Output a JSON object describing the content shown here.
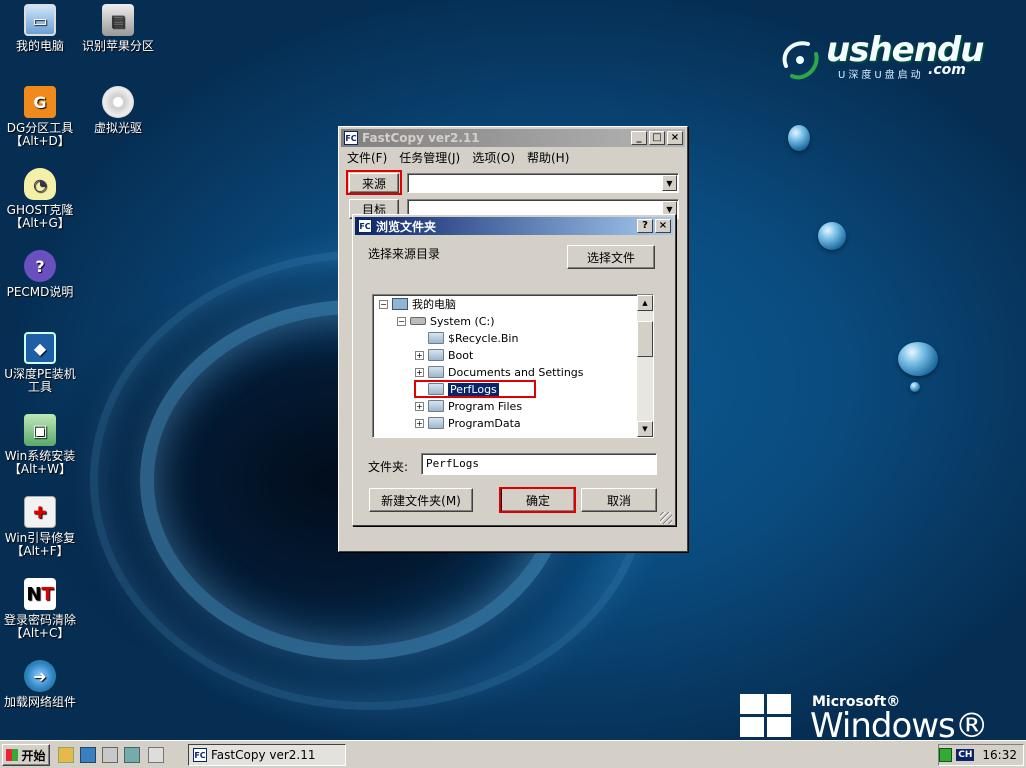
{
  "desktop": {
    "icons": [
      {
        "label": "我的电脑",
        "icon": "computer-icon"
      },
      {
        "label": "识别苹果分区",
        "icon": "disk-icon"
      },
      {
        "label": "DG分区工具\n【Alt+D】",
        "icon": "diskgenius-icon"
      },
      {
        "label": "虚拟光驱",
        "icon": "cd-icon"
      },
      {
        "label": "GHOST克隆\n【Alt+G】",
        "icon": "ghost-icon"
      },
      {
        "label": "PECMD说明",
        "icon": "help-icon"
      },
      {
        "label": "U深度PE装机\n工具",
        "icon": "installer-icon"
      },
      {
        "label": "Win系统安装\n【Alt+W】",
        "icon": "win-setup-icon"
      },
      {
        "label": "Win引导修复\n【Alt+F】",
        "icon": "boot-repair-icon"
      },
      {
        "label": "登录密码清除\n【Alt+C】",
        "icon": "password-icon"
      },
      {
        "label": "加载网络组件",
        "icon": "network-icon"
      }
    ]
  },
  "logo": {
    "word": "ushendu",
    "com": ".com",
    "sub": "U深度U盘启动"
  },
  "winpe": {
    "microsoft": "Microsoft®",
    "windows": "Windows® PE"
  },
  "fastcopy": {
    "title": "FastCopy ver2.11",
    "menu": [
      "文件(F)",
      "任务管理(J)",
      "选项(O)",
      "帮助(H)"
    ],
    "source_button": "来源",
    "dest_button": "目标"
  },
  "browse": {
    "title": "浏览文件夹",
    "prompt": "选择来源目录",
    "select_file_button": "选择文件",
    "tree": [
      {
        "label": "我的电脑",
        "level": 0,
        "expander": "−",
        "type": "computer"
      },
      {
        "label": "System (C:)",
        "level": 1,
        "expander": "−",
        "type": "drive"
      },
      {
        "label": "$Recycle.Bin",
        "level": 2,
        "expander": "",
        "type": "folder"
      },
      {
        "label": "Boot",
        "level": 2,
        "expander": "+",
        "type": "folder"
      },
      {
        "label": "Documents and Settings",
        "level": 2,
        "expander": "+",
        "type": "folder"
      },
      {
        "label": "PerfLogs",
        "level": 2,
        "expander": "",
        "type": "folder",
        "selected": true
      },
      {
        "label": "Program Files",
        "level": 2,
        "expander": "+",
        "type": "folder"
      },
      {
        "label": "ProgramData",
        "level": 2,
        "expander": "+",
        "type": "folder"
      }
    ],
    "folder_label": "文件夹:",
    "folder_value": "PerfLogs",
    "new_folder_button": "新建文件夹(M)",
    "ok_button": "确定",
    "cancel_button": "取消"
  },
  "taskbar": {
    "start": "开始",
    "task": "FastCopy ver2.11",
    "ime": "CH",
    "clock": "16:32"
  },
  "colors": {
    "title_active": "#0a246a",
    "highlight": "#e00000",
    "selection": "#0a246a"
  }
}
